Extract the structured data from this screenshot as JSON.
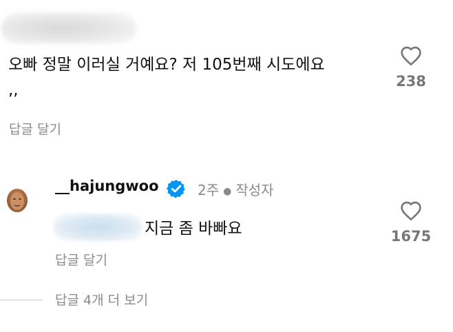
{
  "top_comment": {
    "text": "오빠 정말 이러실 거예요? 저 105번째 시도에요 ,,",
    "reply_label": "답글 달기",
    "like_count": "238"
  },
  "reply": {
    "username": "__hajungwoo",
    "time": "2주",
    "author_badge": "작성자",
    "text": "지금 좀 바빠요",
    "reply_label": "답글 달기",
    "like_count": "1675",
    "verified": true
  },
  "view_replies_label": "답글 4개 더 보기",
  "colors": {
    "verified_blue": "#0095f6",
    "secondary_text": "#8a8a8a"
  },
  "icons": {
    "like": "heart-outline-icon",
    "verified": "verified-badge-icon"
  }
}
